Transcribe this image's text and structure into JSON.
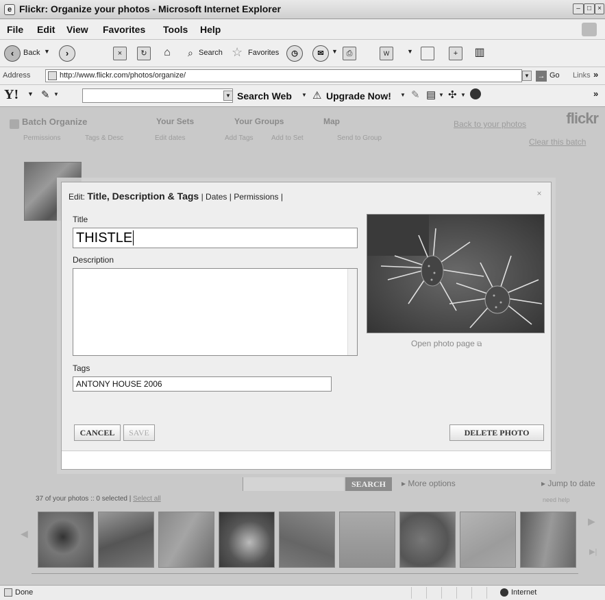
{
  "window": {
    "title": "Flickr: Organize your photos - Microsoft Internet Explorer"
  },
  "menubar": {
    "items": [
      "File",
      "Edit",
      "View",
      "Favorites",
      "Tools",
      "Help"
    ]
  },
  "toolbar": {
    "back_label": "Back",
    "search_label": "Search",
    "favorites_label": "Favorites"
  },
  "address": {
    "label": "Address",
    "url": "http://www.flickr.com/photos/organize/",
    "go_label": "Go",
    "links_label": "Links"
  },
  "yahoo": {
    "logo": "Y!",
    "search_web_label": "Search Web",
    "upgrade_label": "Upgrade Now!"
  },
  "organizr": {
    "tabs": [
      "Batch Organize",
      "Your Sets",
      "Your Groups",
      "Map"
    ],
    "subnav": [
      "Permissions",
      "Tags & Desc",
      "Edit dates",
      "Add Tags",
      "Add to Set",
      "Send to Group"
    ],
    "back_link": "Back to your photos",
    "clear_batch": "Clear this batch",
    "logo": "flickr",
    "search_button": "SEARCH",
    "more_options": "More options",
    "jump_to_date": "Jump to date",
    "need_help": "need help",
    "photo_count": "37 of your photos",
    "selected_text": ":: 0 selected |",
    "select_all": "Select all"
  },
  "dialog": {
    "edit_label": "Edit:",
    "tab_active": "Title, Description & Tags",
    "tab_dates": "Dates",
    "tab_permissions": "Permissions",
    "sep": "|",
    "close_icon_glyph": "×",
    "title_label": "Title",
    "title_value": "THISTLE",
    "description_label": "Description",
    "description_value": "",
    "tags_label": "Tags",
    "tags_value": "ANTONY HOUSE 2006",
    "open_photo_page": "Open photo page",
    "cancel_label": "CANCEL",
    "save_label": "SAVE",
    "delete_label": "DELETE PHOTO"
  },
  "statusbar": {
    "status": "Done",
    "zone": "Internet"
  }
}
